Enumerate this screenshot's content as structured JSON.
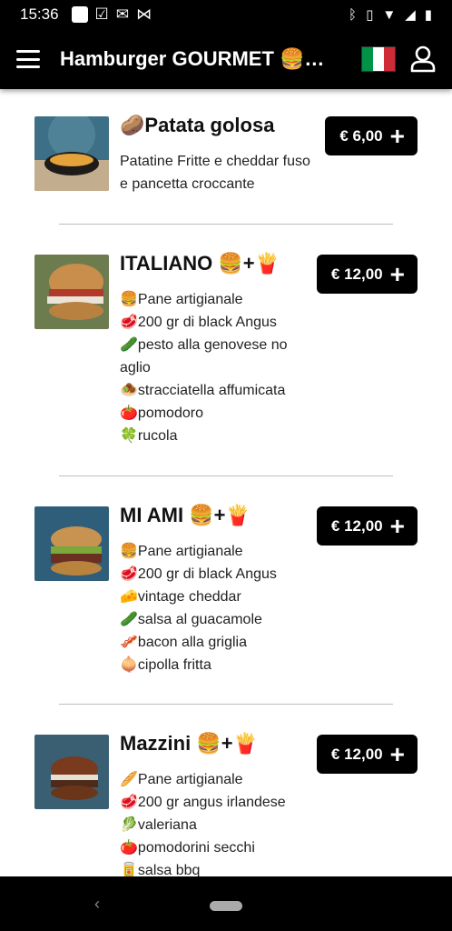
{
  "status": {
    "time": "15:36"
  },
  "header": {
    "title": "Hamburger GOURMET 🍔🍔🍔"
  },
  "items": [
    {
      "name": "🥔Patata golosa",
      "price": "€ 6,00",
      "desc": [
        "Patatine Fritte e cheddar fuso e pancetta croccante"
      ]
    },
    {
      "name": "ITALIANO 🍔+🍟",
      "price": "€ 12,00",
      "desc": [
        "🍔Pane artigianale",
        "🥩200 gr di black Angus",
        "🥒pesto alla genovese no aglio",
        "🧆stracciatella affumicata",
        "🍅pomodoro",
        "🍀rucola"
      ]
    },
    {
      "name": "MI AMI 🍔+🍟",
      "price": "€ 12,00",
      "desc": [
        "🍔Pane artigianale",
        "🥩200 gr di black Angus",
        "🧀vintage cheddar",
        "🥒salsa al guacamole",
        "🥓bacon alla griglia",
        "🧅cipolla fritta"
      ]
    },
    {
      "name": "Mazzini 🍔+🍟",
      "price": "€ 12,00",
      "desc": [
        "🥖Pane artigianale",
        "🥩200 gr angus irlandese",
        "🥬valeriana",
        "🍅pomodorini secchi",
        "🥫salsa bbq"
      ]
    }
  ],
  "colors": {
    "flag_green": "#009246",
    "flag_white": "#ffffff",
    "flag_red": "#ce2b37",
    "bar": "#000000"
  }
}
